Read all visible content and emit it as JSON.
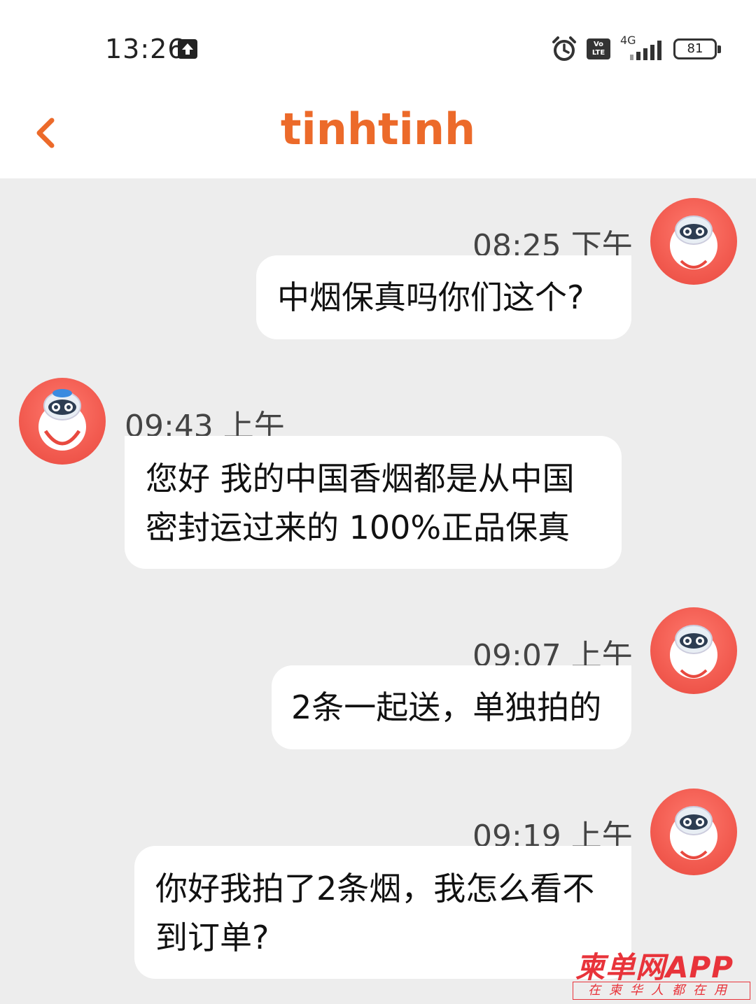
{
  "status_bar": {
    "time": "13:26",
    "network": "4G",
    "volte": "Vo LTE",
    "battery": "81"
  },
  "nav": {
    "title": "tinhtinh"
  },
  "messages": [
    {
      "side": "right",
      "time": "08:25 下午",
      "text": "中烟保真吗你们这个?"
    },
    {
      "side": "left",
      "time": "09:43 上午",
      "text_lines": [
        "您好 我的中国香烟都是从中国",
        "密封运过来的 100%正品保真"
      ]
    },
    {
      "side": "right",
      "time": "09:07 上午",
      "text": "2条一起送，单独拍的"
    },
    {
      "side": "right",
      "time": "09:19 上午",
      "text_lines": [
        "你好我拍了2条烟，我怎么看不",
        "到订单?"
      ]
    }
  ],
  "watermark": {
    "title": "柬单网APP",
    "subtitle": "在柬华人都在用"
  },
  "colors": {
    "brand": "#ec6a2a",
    "avatar": "#f25b50",
    "chat_bg": "#ededed"
  }
}
